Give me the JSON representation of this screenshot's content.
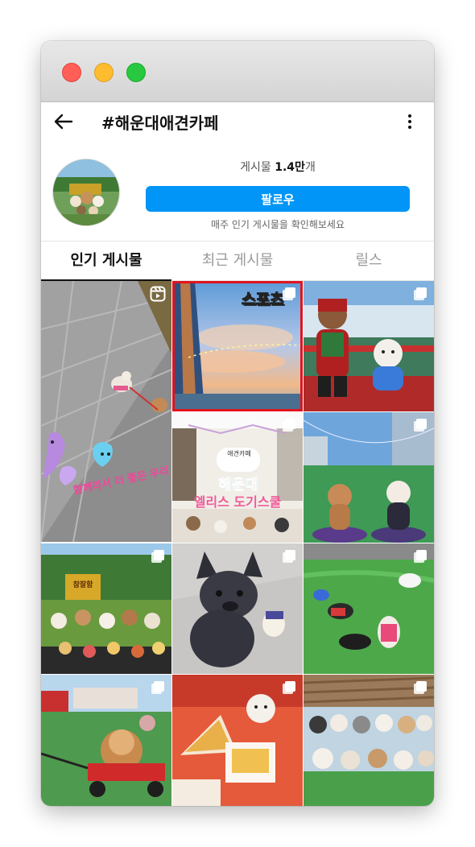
{
  "header": {
    "back_icon": "arrow-left-icon",
    "title": "#해운대애견카페",
    "more_icon": "more-vertical-icon"
  },
  "profile": {
    "post_label": "게시물",
    "post_count": "1.4만",
    "post_suffix": "개",
    "follow_label": "팔로우",
    "subtext": "매주 인기 게시물을 확인해보세요"
  },
  "tabs": [
    {
      "label": "인기 게시물",
      "active": true
    },
    {
      "label": "최근 게시물",
      "active": false
    },
    {
      "label": "릴스",
      "active": false
    }
  ],
  "grid": {
    "posts": [
      {
        "type": "reel",
        "overlay_text": "함께라서 더 좋은 우리"
      },
      {
        "type": "carousel",
        "overlay_text": "스포츠",
        "selected": true
      },
      {
        "type": "carousel"
      },
      {
        "type": "carousel",
        "overlay_text": "애견카페",
        "overlay_text_2": "해운대",
        "overlay_text_3": "엘리스 도기스쿨"
      },
      {
        "type": "carousel"
      },
      {
        "type": "carousel",
        "overlay_text": "참잘함"
      },
      {
        "type": "carousel"
      },
      {
        "type": "carousel"
      },
      {
        "type": "carousel"
      },
      {
        "type": "carousel"
      },
      {
        "type": "carousel"
      }
    ]
  },
  "colors": {
    "follow_button": "#0095f6",
    "selected_outline": "#e0141e",
    "traffic_red": "#ff5f57",
    "traffic_yellow": "#febc2e",
    "traffic_green": "#28c840"
  }
}
